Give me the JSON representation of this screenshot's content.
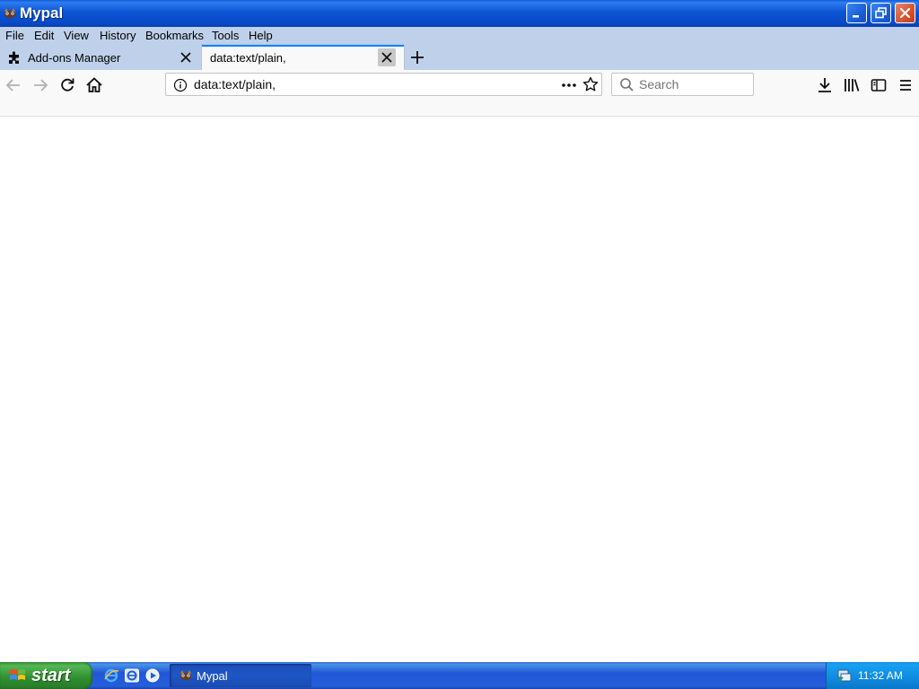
{
  "window": {
    "title": "Mypal",
    "icon": "mypal-icon"
  },
  "menubar": {
    "items": [
      "File",
      "Edit",
      "View",
      "History",
      "Bookmarks",
      "Tools",
      "Help"
    ]
  },
  "tabs": [
    {
      "label": "Add-ons Manager",
      "icon": "puzzle-icon",
      "active": false
    },
    {
      "label": "data:text/plain,",
      "icon": null,
      "active": true
    }
  ],
  "navbar": {
    "url": "data:text/plain,",
    "search_placeholder": "Search"
  },
  "taskbar": {
    "start_label": "start",
    "task_label": "Mypal",
    "clock": "11:32 AM"
  },
  "colors": {
    "accent": "#0a84ff",
    "titlebar": "#0b55d4",
    "menubar": "#bfd1ea",
    "taskbar": "#245edb",
    "start": "#3b9a3b"
  }
}
